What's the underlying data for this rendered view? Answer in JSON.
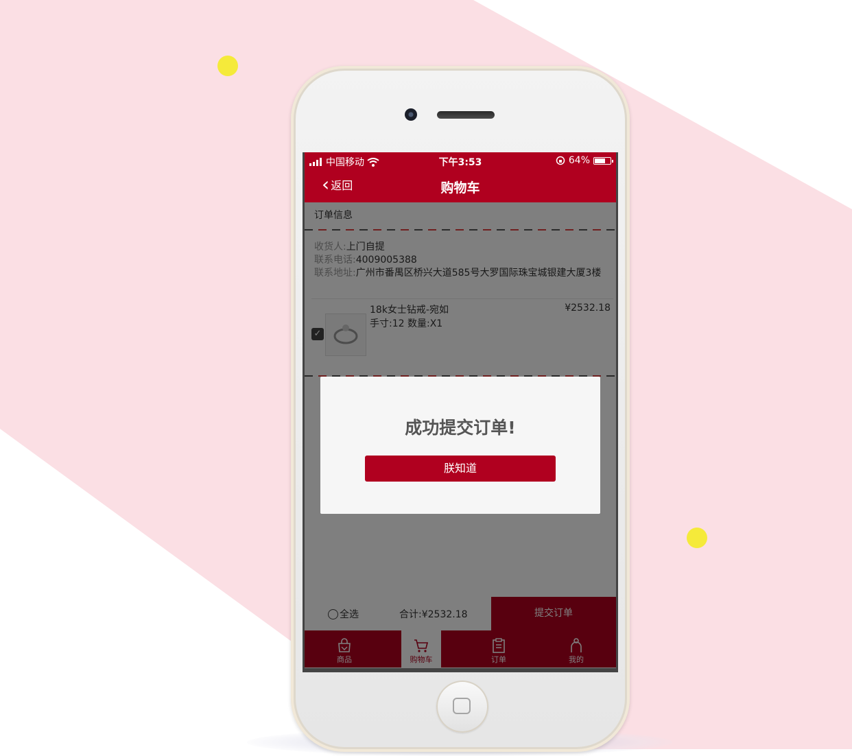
{
  "status_bar": {
    "carrier": "中国移动",
    "time": "下午3:53",
    "battery": "64%"
  },
  "nav": {
    "back_label": "返回",
    "title": "购物车"
  },
  "order": {
    "section_title": "订单信息",
    "receiver_key": "收货人:",
    "receiver_value": "上门自提",
    "phone_key": "联系电话:",
    "phone_value": "4009005388",
    "address_key": "联系地址:",
    "address_value": "广州市番禺区桥兴大道585号大罗国际珠宝城银建大厦3楼"
  },
  "item": {
    "name": "18k女士钻戒-宛如",
    "spec": "手寸:12 数量:X1",
    "price": "¥2532.18",
    "checked": true
  },
  "bottom": {
    "select_all": "全选",
    "total": "合计:¥2532.18",
    "submit": "提交订单"
  },
  "tabs": [
    {
      "label": "商品",
      "icon": "shop-bag-icon",
      "active": false
    },
    {
      "label": "购物车",
      "icon": "cart-icon",
      "active": true
    },
    {
      "label": "订单",
      "icon": "clipboard-icon",
      "active": false
    },
    {
      "label": "我的",
      "icon": "user-icon",
      "active": false
    }
  ],
  "modal": {
    "title": "成功提交订单!",
    "button": "朕知道"
  },
  "colors": {
    "brand_red": "#b0001f",
    "background_pink": "#fbdfe4",
    "dot_yellow": "#f5ea3a"
  }
}
